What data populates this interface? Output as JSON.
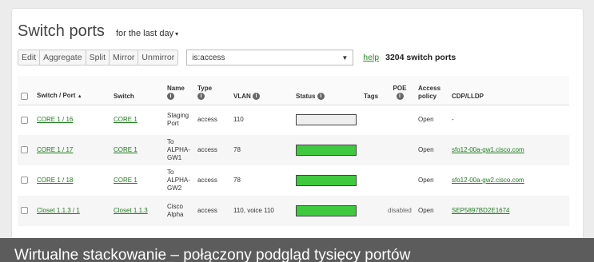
{
  "header": {
    "title": "Switch ports",
    "range_label": "for the last day"
  },
  "toolbar": {
    "buttons": [
      "Edit",
      "Aggregate",
      "Split",
      "Mirror",
      "Unmirror"
    ],
    "search_value": "is:access",
    "help_label": "help",
    "count_label": "3204 switch ports"
  },
  "table": {
    "headers": {
      "switch_port": "Switch / Port",
      "sort_indicator": "▲",
      "switch": "Switch",
      "name": "Name",
      "type": "Type",
      "vlan": "VLAN",
      "status": "Status",
      "tags": "Tags",
      "poe": "POE",
      "access_policy": "Access policy",
      "cdp": "CDP/LLDP"
    },
    "rows": [
      {
        "port": "CORE 1 / 16",
        "switch": "CORE 1",
        "name": "Staging Port",
        "type": "access",
        "vlan": "110",
        "status": "down",
        "tags": "",
        "poe": "",
        "policy": "Open",
        "cdp": "-"
      },
      {
        "port": "CORE 1 / 17",
        "switch": "CORE 1",
        "name": "To ALPHA-GW1",
        "type": "access",
        "vlan": "78",
        "status": "up",
        "tags": "",
        "poe": "",
        "policy": "Open",
        "cdp": "sfo12-00a-gw1.cisco.com"
      },
      {
        "port": "CORE 1 / 18",
        "switch": "CORE 1",
        "name": "To ALPHA-GW2",
        "type": "access",
        "vlan": "78",
        "status": "up",
        "tags": "",
        "poe": "",
        "policy": "Open",
        "cdp": "sfo12-00a-gw2.cisco.com"
      },
      {
        "port": "Closet 1.1.3 / 1",
        "switch": "Closet 1.1.3",
        "name": "Cisco Alpha",
        "type": "access",
        "vlan": "110, voice 110",
        "status": "up",
        "tags": "",
        "poe": "disabled",
        "policy": "Open",
        "cdp": "SEP5897BD2E1674"
      }
    ]
  },
  "banner": {
    "text": "Wirtualne stackowanie – połączony podgląd tysięcy portów"
  },
  "colors": {
    "status_up": "#3ec93e",
    "status_down": "#eeeeee",
    "link": "#1f7d1f",
    "banner_bg": "#5c5c5c"
  }
}
